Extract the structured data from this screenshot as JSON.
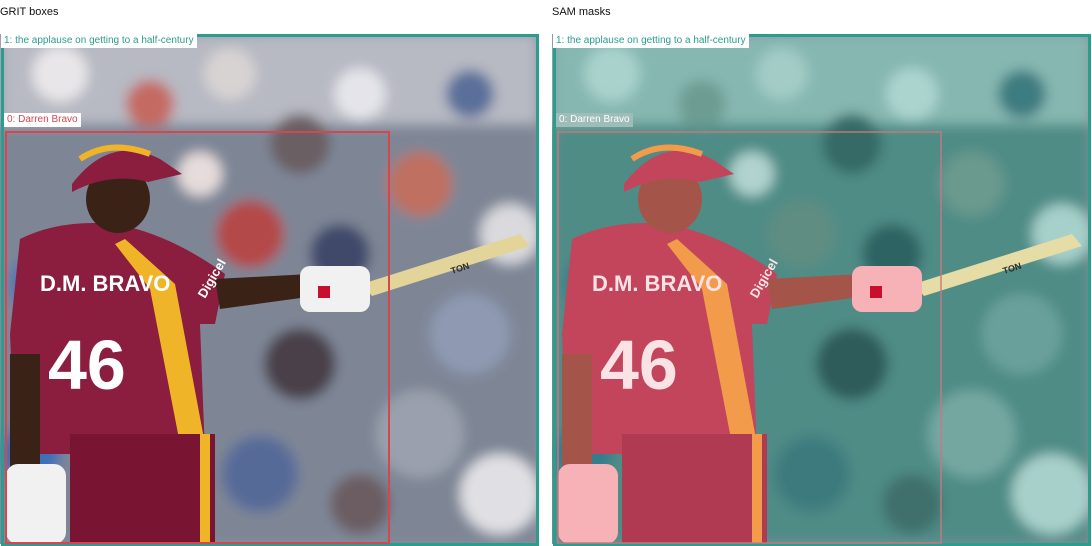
{
  "panels": {
    "left": {
      "title": "GRIT boxes",
      "boxes": [
        {
          "label": "1: the applause on getting to a half-century",
          "color": "#2a9d8f"
        },
        {
          "label": "0: Darren Bravo",
          "color": "#d64550"
        }
      ],
      "shirt_text": "D.M. BRAVO",
      "shirt_number": "46",
      "sleeve_logo": "Digicel",
      "bat_text": "TON"
    },
    "right": {
      "title": "SAM masks",
      "boxes": [
        {
          "label": "1: the applause on getting to a half-century",
          "color": "#2a9d8f"
        },
        {
          "label": "0: Darren Bravo",
          "color": "#c9787e"
        }
      ],
      "shirt_text": "D.M. BRAVO",
      "shirt_number": "46",
      "sleeve_logo": "Digicel",
      "bat_text": "TON",
      "mask_overlay_colors": {
        "crowd": "#2a9d8f",
        "player": "#f4a3a8"
      }
    }
  }
}
